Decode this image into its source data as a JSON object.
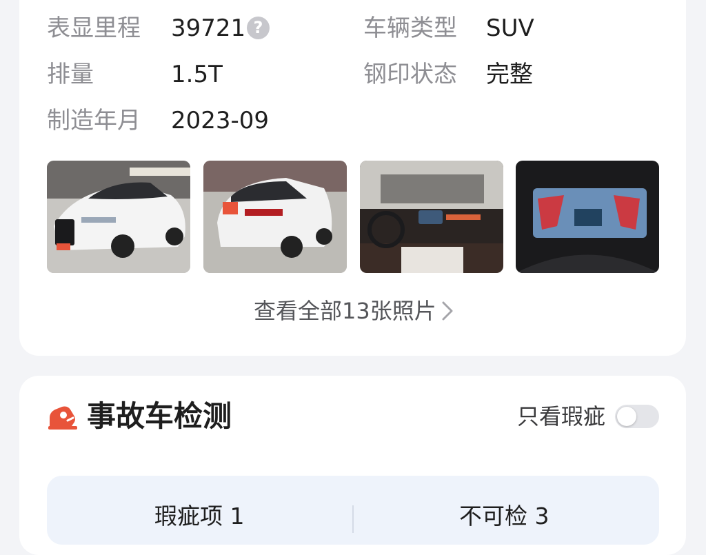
{
  "vehicle_info": {
    "mileage": {
      "label": "表显里程",
      "value": "39721"
    },
    "vehicle_type": {
      "label": "车辆类型",
      "value": "SUV"
    },
    "displacement": {
      "label": "排量",
      "value": "1.5T"
    },
    "stamp_status": {
      "label": "钢印状态",
      "value": "完整"
    },
    "manufacture_date": {
      "label": "制造年月",
      "value": "2023-09"
    }
  },
  "photos": {
    "items": [
      {
        "icon": "car-front-photo"
      },
      {
        "icon": "car-rear-photo"
      },
      {
        "icon": "car-interior-photo"
      },
      {
        "icon": "car-dashboard-photo"
      }
    ],
    "view_all_label": "查看全部13张照片"
  },
  "accident_check": {
    "title": "事故车检测",
    "icon": "car-crash-icon",
    "flaw_only_label": "只看瑕疵",
    "flaw_only_enabled": false,
    "stats": [
      {
        "label": "瑕疵项 1"
      },
      {
        "label": "不可检 3"
      }
    ]
  },
  "colors": {
    "accent": "#e8543a",
    "label": "#8e8e93",
    "card": "#ffffff",
    "background": "#f3f4f7"
  }
}
